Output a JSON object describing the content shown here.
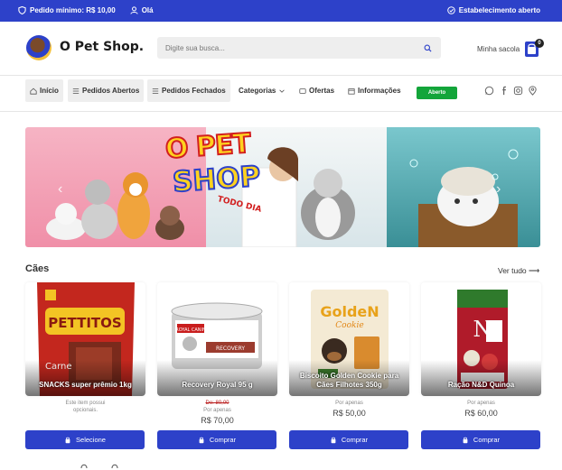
{
  "topbar": {
    "min_order": "Pedido mínimo: R$ 10,00",
    "greeting": "Olá",
    "status": "Estabelecimento aberto"
  },
  "header": {
    "logo_text": "O Pet Shop.",
    "search_placeholder": "Digite sua busca...",
    "cart_label": "Minha sacola",
    "cart_count": "0"
  },
  "nav": {
    "items": [
      {
        "label": "Início",
        "icon": "home-icon"
      },
      {
        "label": "Pedidos Abertos",
        "icon": "list-icon"
      },
      {
        "label": "Pedidos Fechados",
        "icon": "list-icon"
      },
      {
        "label": "Categorias",
        "icon": "chevron-down-icon"
      },
      {
        "label": "Ofertas",
        "icon": "tag-icon"
      },
      {
        "label": "Informações",
        "icon": "calendar-icon"
      }
    ],
    "status_pill": "Aberto",
    "social_icons": [
      "whatsapp-icon",
      "facebook-icon",
      "instagram-icon",
      "location-pin-icon"
    ]
  },
  "banner": {
    "brand_line1": "O PET",
    "brand_line2": "SHOP",
    "brand_line3": "TODO DIA"
  },
  "section": {
    "title": "Cães",
    "see_all": "Ver tudo ⟶"
  },
  "products": [
    {
      "name": "SNACKS super prêmio 1kg",
      "note": "Este item possui opcionais.",
      "old_price": "",
      "price_prefix": "",
      "price": "",
      "button": "Selecione"
    },
    {
      "name": "Recovery Royal 95 g",
      "note": "",
      "old_price": "De: 80,00",
      "price_prefix": "Por apenas",
      "price": "R$ 70,00",
      "button": "Comprar"
    },
    {
      "name": "Biscoito Golden Cookie para Cães Filhotes 350g",
      "note": "",
      "old_price": "",
      "price_prefix": "Por apenas",
      "price": "R$ 50,00",
      "button": "Comprar"
    },
    {
      "name": "Ração N&D Quinoa",
      "note": "",
      "old_price": "",
      "price_prefix": "Por apenas",
      "price": "R$ 60,00",
      "button": "Comprar"
    }
  ],
  "colors": {
    "brand_blue": "#2d41c9",
    "open_green": "#13a53a",
    "old_price_red": "#b22222"
  }
}
